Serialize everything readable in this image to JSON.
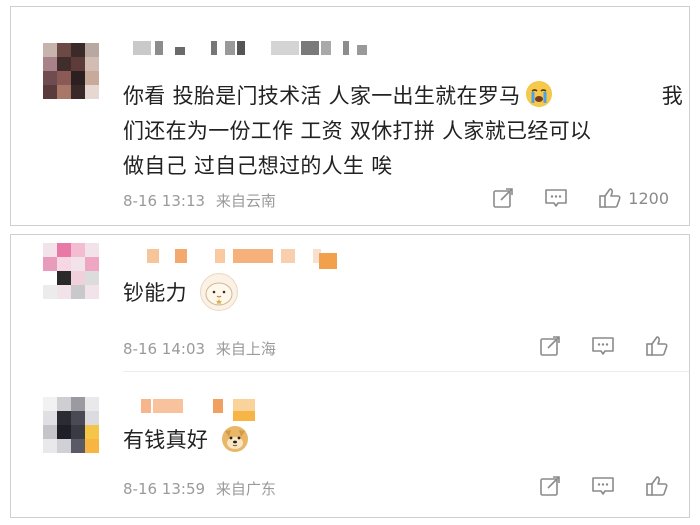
{
  "comments": [
    {
      "text_lines": [
        "你看 投胎是门技术活 人家一出生就在罗马",
        "们还在为一份工作 工资 双休打拼 人家就已经可以",
        "做自己 过自己想过的人生 唉"
      ],
      "text_tail_1": "我",
      "emoji": "crying-face",
      "timestamp": "8-16 13:13",
      "location": "来自云南",
      "like_count": "1200"
    },
    {
      "text": "钞能力",
      "emoji": "cute-sticker",
      "timestamp": "8-16 14:03",
      "location": "来自上海"
    },
    {
      "text": "有钱真好",
      "emoji": "doge",
      "timestamp": "8-16 13:59",
      "location": "来自广东"
    }
  ],
  "colors": {
    "text": "#222222",
    "meta": "#9a9a9a",
    "icon": "#8a8a8a",
    "border": "#cfcfcf"
  },
  "icons": [
    "share-icon",
    "comment-icon",
    "like-icon"
  ]
}
